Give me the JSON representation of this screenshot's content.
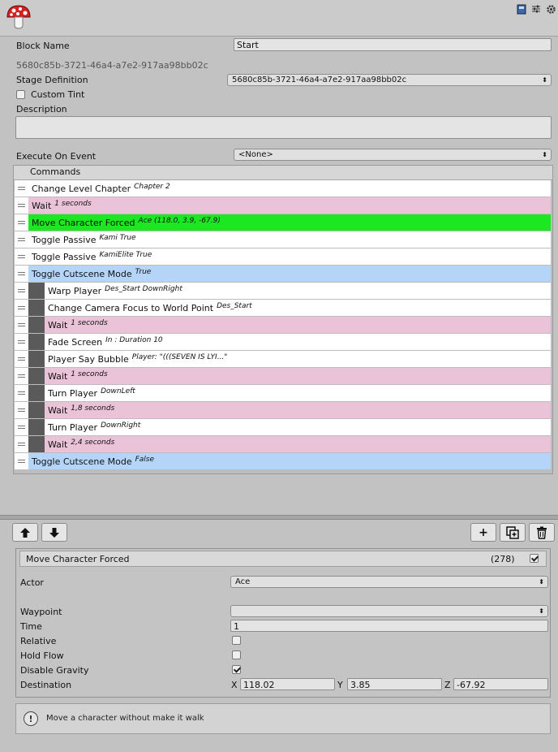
{
  "header": {
    "icons": [
      "book-icon",
      "sliders-icon",
      "gear-icon"
    ]
  },
  "block": {
    "name_label": "Block Name",
    "name_value": "Start",
    "guid": "5680c85b-3721-46a4-a7e2-917aa98bb02c",
    "stage_label": "Stage Definition",
    "stage_value": "5680c85b-3721-46a4-a7e2-917aa98bb02c",
    "custom_tint_label": "Custom Tint",
    "custom_tint_checked": false,
    "description_label": "Description",
    "description_value": "",
    "execute_label": "Execute On Event",
    "execute_value": "<None>"
  },
  "commands": {
    "header": "Commands",
    "rows": [
      {
        "name": "Change Level Chapter",
        "summary": "Chapter 2",
        "color": "white",
        "indent": 0
      },
      {
        "name": "Wait",
        "summary": "1 seconds",
        "color": "pink",
        "indent": 0
      },
      {
        "name": "Move Character Forced",
        "summary": "Ace          (118.0, 3.9, -67.9)",
        "color": "green",
        "indent": 0
      },
      {
        "name": "Toggle Passive",
        "summary": "Kami    True",
        "color": "white",
        "indent": 0
      },
      {
        "name": "Toggle Passive",
        "summary": "KamiElite    True",
        "color": "white",
        "indent": 0
      },
      {
        "name": "Toggle Cutscene Mode",
        "summary": "True",
        "color": "blue",
        "indent": 0
      },
      {
        "name": "Warp Player",
        "summary": "Des_Start      DownRight",
        "color": "white",
        "indent": 1
      },
      {
        "name": "Change Camera Focus to World Point",
        "summary": "Des_Start",
        "color": "white",
        "indent": 1
      },
      {
        "name": "Wait",
        "summary": "1 seconds",
        "color": "pink",
        "indent": 1
      },
      {
        "name": "Fade Screen",
        "summary": "In : Duration 10",
        "color": "white",
        "indent": 1
      },
      {
        "name": "Player Say Bubble",
        "summary": "Player: \"(((SEVEN IS LYI...\"",
        "color": "white",
        "indent": 1
      },
      {
        "name": "Wait",
        "summary": "1 seconds",
        "color": "pink",
        "indent": 1
      },
      {
        "name": "Turn Player",
        "summary": "DownLeft",
        "color": "white",
        "indent": 1
      },
      {
        "name": "Wait",
        "summary": "1,8 seconds",
        "color": "pink",
        "indent": 1
      },
      {
        "name": "Turn Player",
        "summary": "DownRight",
        "color": "white",
        "indent": 1
      },
      {
        "name": "Wait",
        "summary": "2,4 seconds",
        "color": "pink",
        "indent": 1
      },
      {
        "name": "Toggle Cutscene Mode",
        "summary": "False",
        "color": "blue",
        "indent": 0
      }
    ]
  },
  "toolbar": {
    "up": "↑",
    "down": "↓",
    "add": "+",
    "duplicate": "⧉",
    "delete": "🗑"
  },
  "inspector": {
    "title": "Move Character Forced",
    "count": "(278)",
    "enabled": true,
    "actor_label": "Actor",
    "actor_value": "Ace",
    "waypoint_label": "Waypoint",
    "waypoint_value": "",
    "time_label": "Time",
    "time_value": "1",
    "relative_label": "Relative",
    "relative_checked": false,
    "holdflow_label": "Hold Flow",
    "holdflow_checked": false,
    "disablegravity_label": "Disable Gravity",
    "disablegravity_checked": true,
    "destination_label": "Destination",
    "dest_x_label": "X",
    "dest_x": "118.02",
    "dest_y_label": "Y",
    "dest_y": "3.85",
    "dest_z_label": "Z",
    "dest_z": "-67.92"
  },
  "help": {
    "icon": "!",
    "text": "Move a character without make it walk"
  },
  "colors": {
    "white": "#ffffff",
    "pink": "#ebc3d8",
    "green": "#1ce822",
    "blue": "#b4d5f8"
  }
}
